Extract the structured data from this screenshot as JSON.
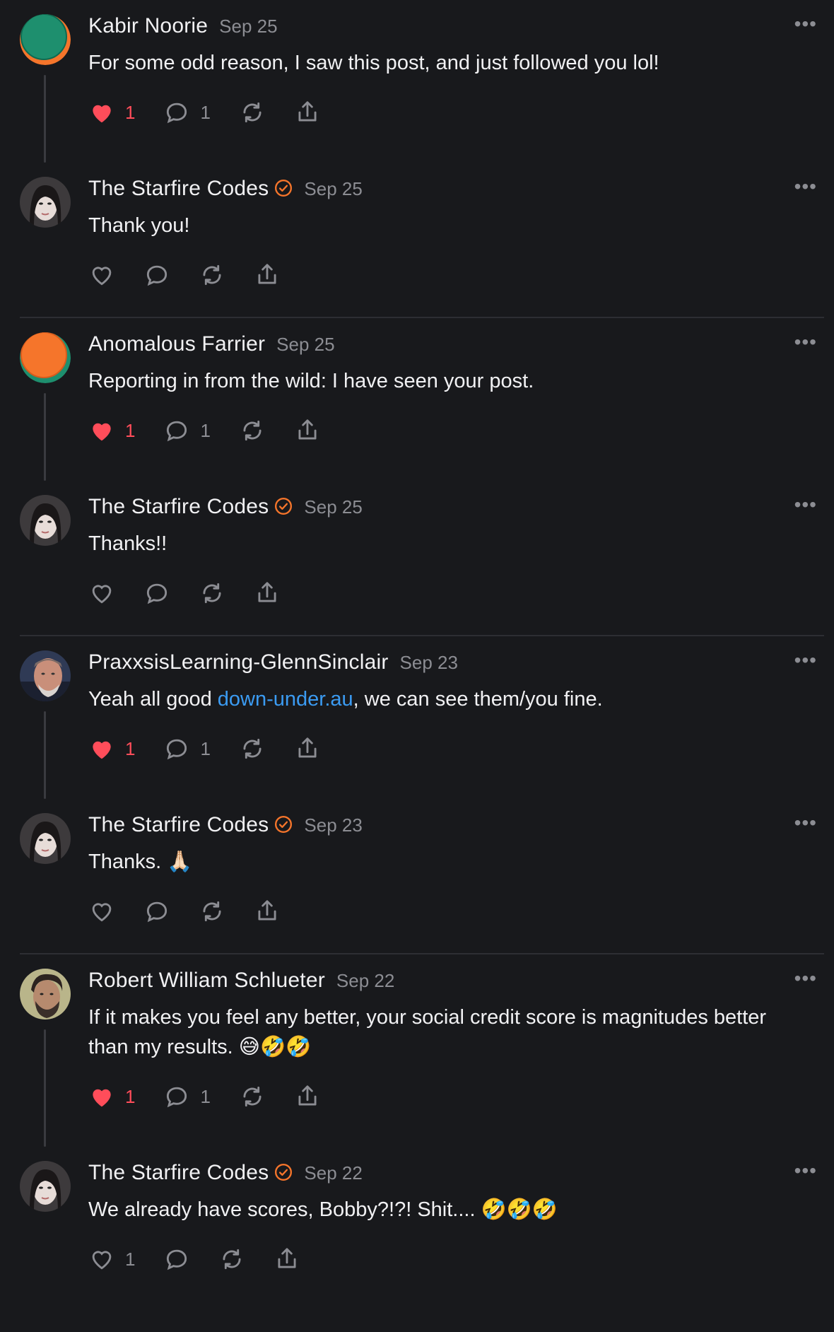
{
  "comments": [
    {
      "author": "Kabir Noorie",
      "date": "Sep 25",
      "text": "For some odd reason, I saw this post, and just followed you lol!",
      "likes": "1",
      "replies": "1",
      "liked": true,
      "verified": false,
      "avatar": "green-orange-circle"
    },
    {
      "author": "The Starfire Codes",
      "date": "Sep 25",
      "text": "Thank you!",
      "likes": "",
      "replies": "",
      "liked": false,
      "verified": true,
      "avatar": "portrait"
    },
    {
      "author": "Anomalous Farrier",
      "date": "Sep 25",
      "text": "Reporting in from the wild: I have seen your post.",
      "likes": "1",
      "replies": "1",
      "liked": true,
      "verified": false,
      "avatar": "orange-green-circle"
    },
    {
      "author": "The Starfire Codes",
      "date": "Sep 25",
      "text": "Thanks!!",
      "likes": "",
      "replies": "",
      "liked": false,
      "verified": true,
      "avatar": "portrait"
    },
    {
      "author": "PraxxsisLearning-GlennSinclair",
      "date": "Sep 23",
      "text_pre": "Yeah all good ",
      "link": "down-under.au",
      "text_post": ", we can see them/you fine.",
      "likes": "1",
      "replies": "1",
      "liked": true,
      "verified": false,
      "avatar": "man-portrait"
    },
    {
      "author": "The Starfire Codes",
      "date": "Sep 23",
      "text": "Thanks. 🙏🏻",
      "likes": "",
      "replies": "",
      "liked": false,
      "verified": true,
      "avatar": "portrait"
    },
    {
      "author": "Robert William Schlueter",
      "date": "Sep 22",
      "text": "If it makes you feel any better, your social credit score is magnitudes better than my results. 😅🤣🤣",
      "likes": "1",
      "replies": "1",
      "liked": true,
      "verified": false,
      "avatar": "man-beard-portrait"
    },
    {
      "author": "The Starfire Codes",
      "date": "Sep 22",
      "text": "We already have scores, Bobby?!?! Shit.... 🤣🤣🤣",
      "likes": "1",
      "replies": "",
      "liked": false,
      "verified": true,
      "avatar": "portrait"
    }
  ],
  "more_label": "•••",
  "colors": {
    "background": "#18191c",
    "like": "#ff4d5a",
    "verified": "#f5752b",
    "link": "#3b9bf2",
    "muted": "#8c8d93"
  }
}
